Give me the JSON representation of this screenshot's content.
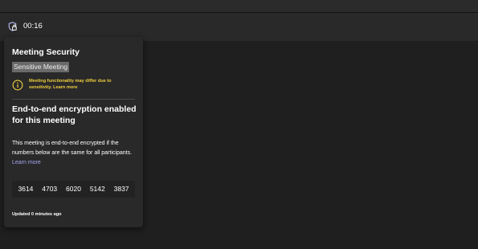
{
  "toolbar": {
    "timer": "00:16",
    "security_icon": "shield-lock-icon"
  },
  "panel": {
    "title": "Meeting Security",
    "sensitivity_label": "Sensitive Meeting",
    "warning": {
      "icon": "info-circle-icon",
      "text": "Meeting functionality may differ due to sensitivity.",
      "link": "Learn more"
    },
    "e2e_heading": "End-to-end encryption enabled for this meeting",
    "e2e_description": "This meeting is end-to-end encrypted if the numbers below are the same for all participants.",
    "e2e_link": "Learn more",
    "codes": [
      "3614",
      "4703",
      "6020",
      "5142",
      "3837"
    ],
    "updated": "Updated 0 minutes ago"
  },
  "colors": {
    "background": "#1f1f1f",
    "panel": "#292929",
    "warning_text": "#f0cf40",
    "link": "#a5a8ef",
    "tag_background": "#6a6a6a"
  }
}
